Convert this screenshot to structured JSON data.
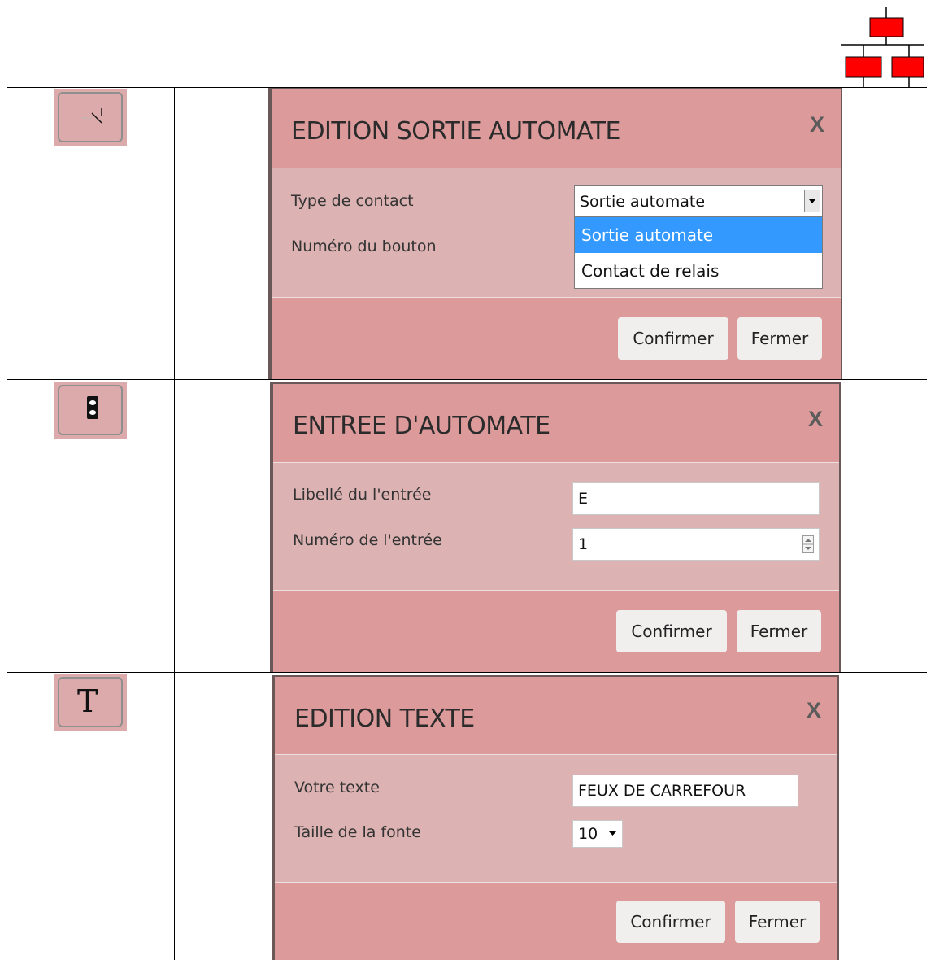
{
  "dialog_output": {
    "title": "EDITION SORTIE AUTOMATE",
    "close": "X",
    "labels": {
      "type": "Type de contact",
      "number": "Numéro du bouton"
    },
    "select_value": "Sortie automate",
    "options": [
      "Sortie automate",
      "Contact de relais"
    ],
    "confirm": "Confirmer",
    "close_button": "Fermer"
  },
  "dialog_input": {
    "title": "ENTREE D'AUTOMATE",
    "close": "X",
    "labels": {
      "label": "Libellé du l'entrée",
      "number": "Numéro de l'entrée"
    },
    "label_value": "E",
    "number_value": "1",
    "confirm": "Confirmer",
    "close_button": "Fermer"
  },
  "dialog_text": {
    "title": "EDITION TEXTE",
    "close": "X",
    "labels": {
      "text": "Votre texte",
      "font_size": "Taille de la fonte"
    },
    "text_value": "FEUX DE CARREFOUR",
    "font_size_value": "10",
    "confirm": "Confirmer",
    "close_button": "Fermer"
  },
  "tools": {
    "text_icon_glyph": "T"
  },
  "colors": {
    "dialog_bg": "#dc9a9a",
    "dialog_body": "#dcb2b2",
    "selected_option": "#3399ff",
    "logo_red": "#ff0000"
  }
}
